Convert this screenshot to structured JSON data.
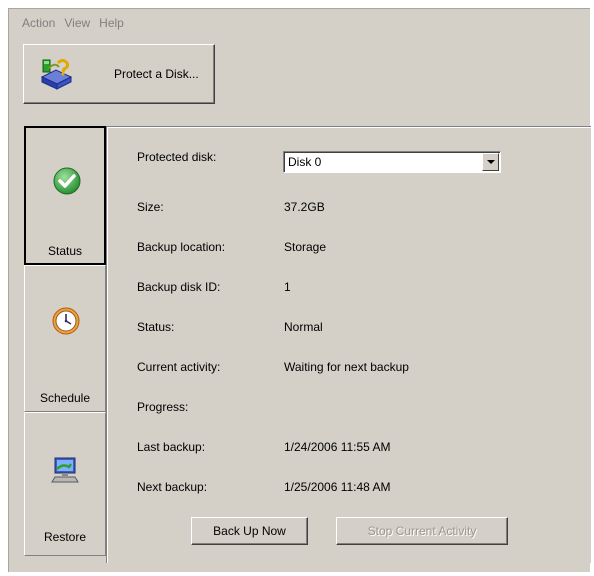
{
  "menu": [
    "Action",
    "View",
    "Help"
  ],
  "toolbar": {
    "protect_label": "Protect a Disk...",
    "protect_icon": "disk-protect-icon"
  },
  "tabs": [
    {
      "label": "Status",
      "icon": "check-icon",
      "active": true
    },
    {
      "label": "Schedule",
      "icon": "clock-icon",
      "active": false
    },
    {
      "label": "Restore",
      "icon": "restore-icon",
      "active": false
    }
  ],
  "status": {
    "protected_disk_label": "Protected disk:",
    "protected_disk_value": "Disk 0",
    "size_label": "Size:",
    "size_value": "37.2GB",
    "backup_location_label": "Backup location:",
    "backup_location_value": "Storage",
    "backup_disk_id_label": "Backup disk ID:",
    "backup_disk_id_value": "1",
    "status_label": "Status:",
    "status_value": "Normal",
    "current_activity_label": "Current activity:",
    "current_activity_value": "Waiting for next backup",
    "progress_label": "Progress:",
    "last_backup_label": "Last backup:",
    "last_backup_value": "1/24/2006 11:55 AM",
    "next_backup_label": "Next backup:",
    "next_backup_value": "1/25/2006 11:48 AM"
  },
  "actions": {
    "back_up_now": "Back Up Now",
    "stop_current_activity": "Stop Current Activity"
  },
  "colors": {
    "face": "#d4d0c8",
    "disabled_text": "#9a978f",
    "menu_text": "#808080"
  }
}
